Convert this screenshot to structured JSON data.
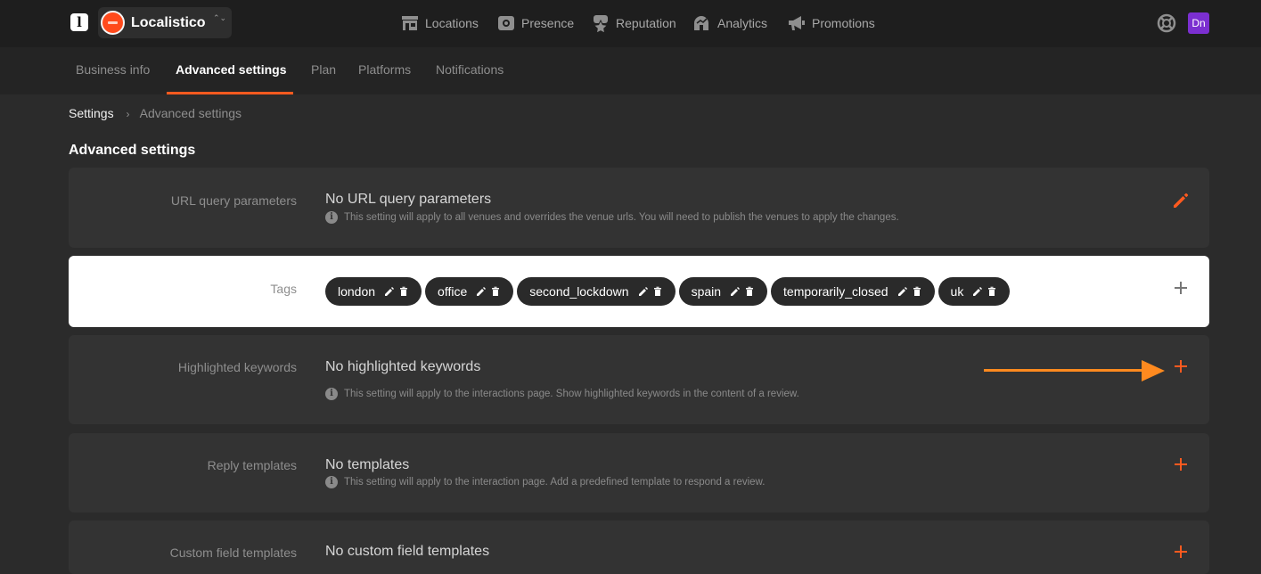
{
  "app": {
    "logo_glyph": "l",
    "account_name": "Localistico",
    "chevrons": "⌃⌄"
  },
  "main_nav": [
    {
      "label": "Locations",
      "icon": "store-icon"
    },
    {
      "label": "Presence",
      "icon": "presence-icon"
    },
    {
      "label": "Reputation",
      "icon": "reputation-icon"
    },
    {
      "label": "Analytics",
      "icon": "analytics-icon"
    },
    {
      "label": "Promotions",
      "icon": "megaphone-icon"
    }
  ],
  "user": {
    "initials": "Dn",
    "avatar_color": "#7b2fd0"
  },
  "subnav": {
    "tabs": [
      "Business info",
      "Advanced settings",
      "Plan",
      "Platforms",
      "Notifications"
    ],
    "active": "Advanced settings"
  },
  "breadcrumb": {
    "root": "Settings",
    "separator": "›",
    "current": "Advanced settings"
  },
  "page_title": "Advanced settings",
  "colors": {
    "accent": "#ff5a1f",
    "annotation_arrow": "#ff8a1f"
  },
  "settings": {
    "url_params": {
      "label": "URL query parameters",
      "value": "No URL query parameters",
      "hint": "This setting will apply to all venues and overrides the venue urls. You will need to publish the venues to apply the changes.",
      "action_icon": "pencil-icon"
    },
    "tags": {
      "label": "Tags",
      "items": [
        "london",
        "office",
        "second_lockdown",
        "spain",
        "temporarily_closed",
        "uk"
      ],
      "action_icon": "plus-icon"
    },
    "keywords": {
      "label": "Highlighted keywords",
      "value": "No highlighted keywords",
      "hint": "This setting will apply to the interactions page. Show highlighted keywords in the content of a review.",
      "action_icon": "plus-icon"
    },
    "reply_templates": {
      "label": "Reply templates",
      "value": "No templates",
      "hint": "This setting will apply to the interaction page. Add a predefined template to respond a review.",
      "action_icon": "plus-icon"
    },
    "custom_fields": {
      "label": "Custom field templates",
      "value": "No custom field templates",
      "action_icon": "plus-icon"
    }
  }
}
